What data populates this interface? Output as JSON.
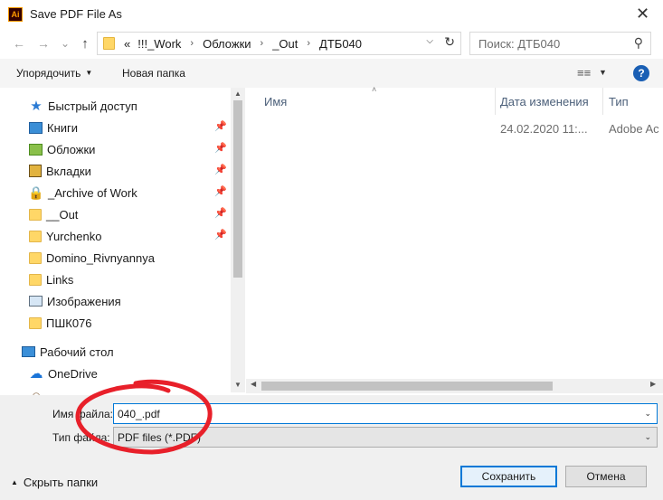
{
  "window": {
    "app_icon_text": "Ai",
    "title": "Save PDF File As",
    "close_glyph": "✕"
  },
  "nav": {
    "back_glyph": "←",
    "forward_glyph": "→",
    "history_glyph": "⌄",
    "up_glyph": "↑",
    "breadcrumbs": [
      "«",
      "!!!_Work",
      "Обложки",
      "_Out",
      "ДТБ040"
    ],
    "separator": "›",
    "search_placeholder": "Поиск: ДТБ040"
  },
  "toolbar": {
    "organize_label": "Упорядочить",
    "new_folder_label": "Новая папка",
    "help_label": "?"
  },
  "sidebar": {
    "items": [
      {
        "label": "Быстрый доступ",
        "icon": "star-icon",
        "pinned": false
      },
      {
        "label": "Книги",
        "icon": "books-icon",
        "pinned": true
      },
      {
        "label": "Обложки",
        "icon": "covers-icon",
        "pinned": true
      },
      {
        "label": "Вкладки",
        "icon": "tabs-icon",
        "pinned": true
      },
      {
        "label": "_Archive of Work",
        "icon": "lock-folder-icon",
        "pinned": true
      },
      {
        "label": "__Out",
        "icon": "folder-icon",
        "pinned": true
      },
      {
        "label": "Yurchenko",
        "icon": "folder-icon",
        "pinned": true
      },
      {
        "label": "Domino_Rivnyannya",
        "icon": "folder-icon",
        "pinned": false
      },
      {
        "label": "Links",
        "icon": "folder-icon",
        "pinned": false
      },
      {
        "label": "Изображения",
        "icon": "images-icon",
        "pinned": false
      },
      {
        "label": "ПШК076",
        "icon": "folder-icon",
        "pinned": false
      },
      {
        "label": "Рабочий стол",
        "icon": "desktop-icon",
        "pinned": false
      },
      {
        "label": "OneDrive",
        "icon": "cloud-icon",
        "pinned": false
      },
      {
        "label": "",
        "icon": "user-icon",
        "pinned": false
      }
    ]
  },
  "file_list": {
    "columns": [
      "Имя",
      "Дата изменения",
      "Тип"
    ],
    "rows": [
      {
        "name": "",
        "date": "24.02.2020 11:...",
        "type": "Adobe Ac"
      }
    ]
  },
  "bottom": {
    "filename_label": "Имя файла:",
    "filename_value": "040_.pdf",
    "filetype_label": "Тип файла:",
    "filetype_value": "PDF files (*.PDF)",
    "hide_folders_label": "Скрыть папки",
    "save_label": "Сохранить",
    "cancel_label": "Отмена"
  },
  "colors": {
    "accent": "#0078d7",
    "annotation": "#e8202a",
    "folder": "#ffd767"
  }
}
